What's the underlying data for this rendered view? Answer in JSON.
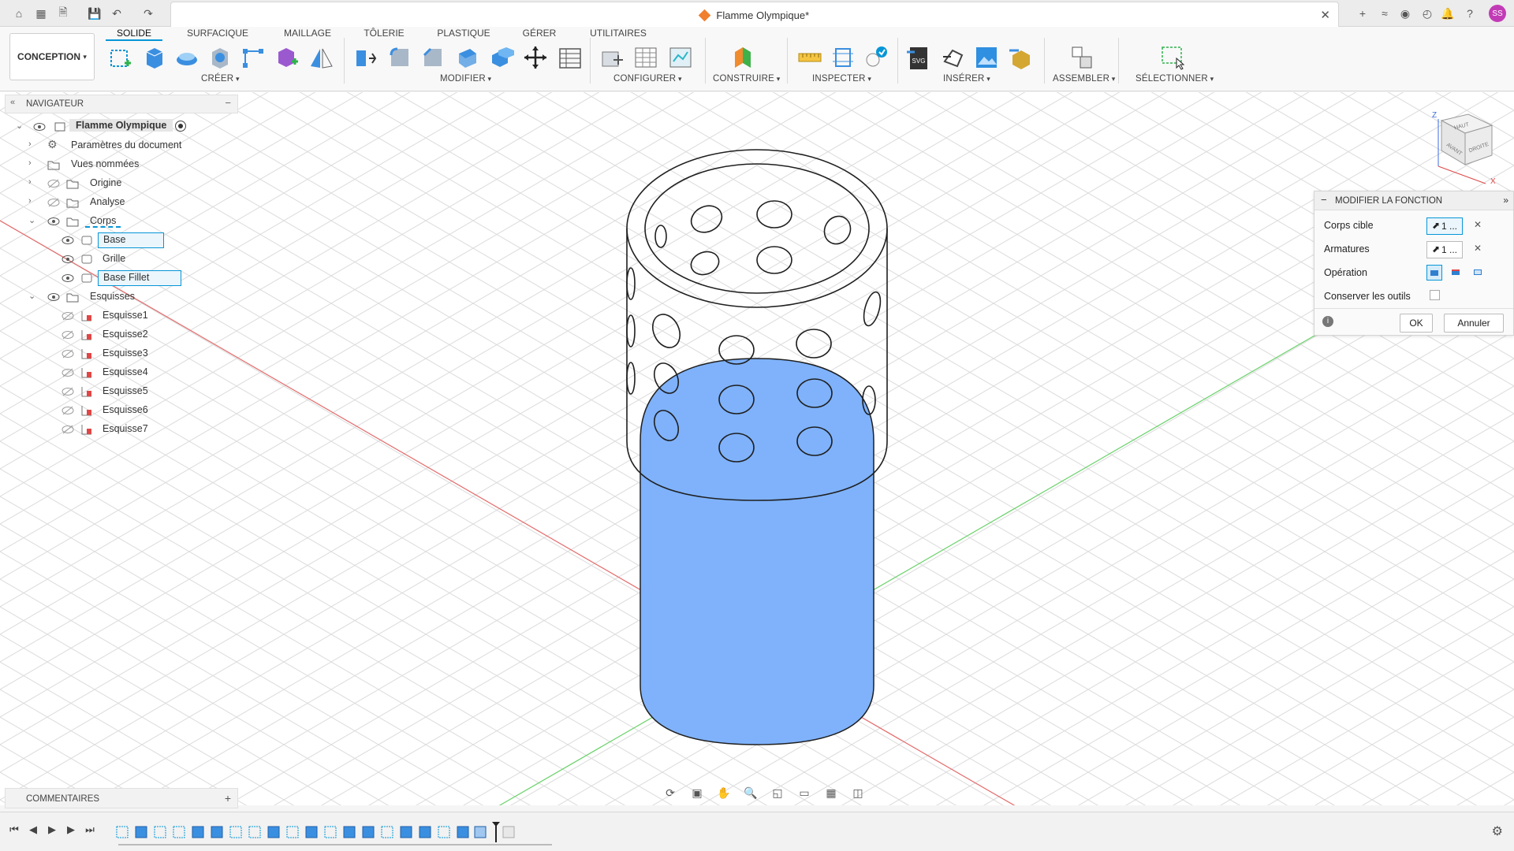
{
  "document": {
    "title": "Flamme Olympique*"
  },
  "user": {
    "initials": "SS",
    "avatar_color": "#c23bb6"
  },
  "ribbon": {
    "workspace": "CONCEPTION",
    "tabs": [
      "SOLIDE",
      "SURFACIQUE",
      "MAILLAGE",
      "TÔLERIE",
      "PLASTIQUE",
      "GÉRER",
      "UTILITAIRES"
    ],
    "active_tab": "SOLIDE",
    "groups": [
      "CRÉER",
      "MODIFIER",
      "CONFIGURER",
      "CONSTRUIRE",
      "INSPECTER",
      "INSÉRER",
      "ASSEMBLER",
      "SÉLECTIONNER"
    ]
  },
  "navigator": {
    "title": "NAVIGATEUR",
    "root": "Flamme Olympique",
    "items": [
      {
        "label": "Paramètres du document",
        "icon": "gear-icon"
      },
      {
        "label": "Vues nommées",
        "icon": "folder-icon"
      },
      {
        "label": "Origine",
        "icon": "folder-icon"
      },
      {
        "label": "Analyse",
        "icon": "folder-icon"
      },
      {
        "label": "Corps",
        "icon": "folder-icon"
      },
      {
        "label": "Base",
        "icon": "body-icon",
        "selected": true
      },
      {
        "label": "Grille",
        "icon": "body-icon"
      },
      {
        "label": "Base Fillet",
        "icon": "body-icon",
        "selected": true
      },
      {
        "label": "Esquisses",
        "icon": "folder-icon"
      },
      {
        "label": "Esquisse1",
        "icon": "sketch-icon"
      },
      {
        "label": "Esquisse2",
        "icon": "sketch-icon"
      },
      {
        "label": "Esquisse3",
        "icon": "sketch-icon"
      },
      {
        "label": "Esquisse4",
        "icon": "sketch-icon"
      },
      {
        "label": "Esquisse5",
        "icon": "sketch-icon"
      },
      {
        "label": "Esquisse6",
        "icon": "sketch-icon"
      },
      {
        "label": "Esquisse7",
        "icon": "sketch-icon"
      }
    ]
  },
  "modify_panel": {
    "title": "MODIFIER LA FONCTION",
    "rows": {
      "target": {
        "label": "Corps cible",
        "value": "1 ..."
      },
      "tools": {
        "label": "Armatures",
        "value": "1 ..."
      },
      "operation": {
        "label": "Opération"
      },
      "keep": {
        "label": "Conserver les outils",
        "checked": false
      }
    },
    "ok": "OK",
    "cancel": "Annuler"
  },
  "viewcube": {
    "top": "HAUT",
    "front": "AVANT",
    "right": "DROITE",
    "axis_z": "Z",
    "axis_x": "X"
  },
  "comments": {
    "title": "COMMENTAIRES"
  },
  "colors": {
    "accent": "#0696d7",
    "body_fill": "#7fb2fb",
    "body_stroke": "#2a2a2a",
    "x_axis": "#e46a6a",
    "y_axis": "#6ad26a"
  }
}
